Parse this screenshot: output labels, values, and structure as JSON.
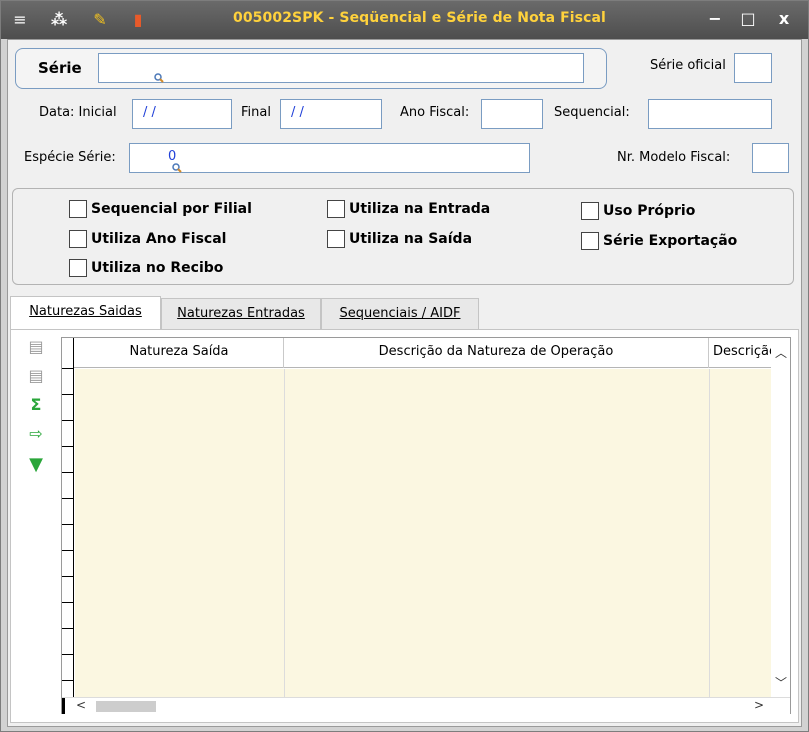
{
  "window": {
    "title": "005002SPK - Seqüencial e Série de Nota Fiscal",
    "minimize": "−",
    "maximize": "□",
    "close": "x",
    "title_color": "#ffd23c"
  },
  "form": {
    "serie_label": "Série",
    "serie_value": "",
    "serie_oficial_label": "Série oficial",
    "serie_oficial_value": "",
    "data_inicial_label": "Data: Inicial",
    "data_inicial_value": "/ /",
    "data_final_label": "Final",
    "data_final_value": "/ /",
    "ano_fiscal_label": "Ano Fiscal:",
    "ano_fiscal_value": "",
    "sequencial_label": "Sequencial:",
    "sequencial_value": "",
    "especie_serie_label": "Espécie Série:",
    "especie_serie_value": "0",
    "nr_modelo_fiscal_label": "Nr. Modelo Fiscal:",
    "nr_modelo_fiscal_value": ""
  },
  "options": {
    "sequencial_por_filial": "Sequencial por Filial",
    "utiliza_ano_fiscal": "Utiliza Ano Fiscal",
    "utiliza_no_recibo": "Utiliza no Recibo",
    "utiliza_na_entrada": "Utiliza na Entrada",
    "utiliza_na_saida": "Utiliza na Saída",
    "uso_proprio": "Uso Próprio",
    "serie_exportacao": "Série Exportação"
  },
  "tabs": [
    {
      "label": "Naturezas Saidas",
      "active": true
    },
    {
      "label": "Naturezas Entradas",
      "active": false
    },
    {
      "label": "Sequenciais / AIDF",
      "active": false
    }
  ],
  "grid": {
    "columns": [
      "Natureza Saída",
      "Descrição da Natureza de Operação",
      "Descrição"
    ],
    "row_color": "#fbf7e1"
  },
  "toolbar_icons": [
    "grid-add-row-icon",
    "grid-delete-row-icon",
    "sum-icon",
    "export-icon",
    "filter-icon"
  ]
}
